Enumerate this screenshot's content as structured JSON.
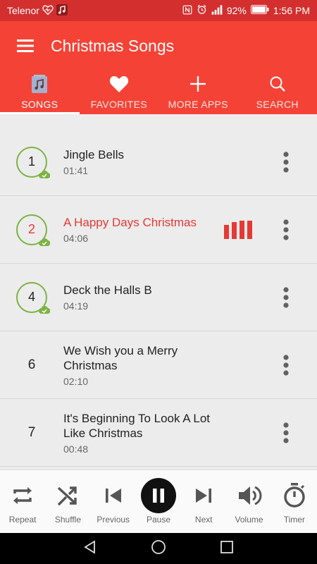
{
  "status": {
    "carrier": "Telenor",
    "battery": "92%",
    "time": "1:56 PM"
  },
  "app": {
    "title": "Christmas Songs",
    "accent": "#f44336",
    "accent_dark": "#d32f2f"
  },
  "tabs": [
    {
      "label": "SONGS",
      "icon": "music-note-icon",
      "active": true
    },
    {
      "label": "FAVORITES",
      "icon": "heart-icon"
    },
    {
      "label": "MORE APPS",
      "icon": "plus-icon"
    },
    {
      "label": "SEARCH",
      "icon": "search-icon"
    }
  ],
  "songs": [
    {
      "number": "1",
      "title": "Jingle Bells",
      "duration": "01:41",
      "downloaded": true
    },
    {
      "number": "2",
      "title": "A Happy Days Christmas",
      "duration": "04:06",
      "downloaded": true,
      "playing": true
    },
    {
      "number": "4",
      "title": "Deck the Halls B",
      "duration": "04:19",
      "downloaded": true
    },
    {
      "number": "6",
      "title": "We Wish you a Merry Christmas",
      "duration": "02:10"
    },
    {
      "number": "7",
      "title": "It's Beginning To Look A Lot Like Christmas",
      "duration": "00:48"
    }
  ],
  "player": {
    "repeat": "Repeat",
    "shuffle": "Shuffle",
    "previous": "Previous",
    "pause": "Pause",
    "next": "Next",
    "volume": "Volume",
    "timer": "Timer"
  }
}
